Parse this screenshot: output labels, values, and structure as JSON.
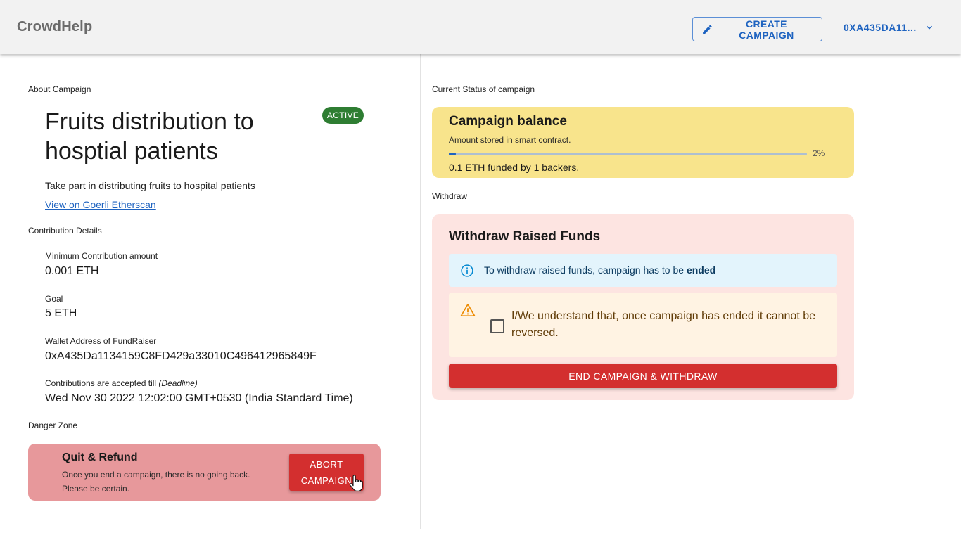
{
  "header": {
    "brand": "CrowdHelp",
    "create_campaign_label": "CREATE CAMPAIGN",
    "account_label": "0XA435DA11...",
    "create_icon": "pencil-icon",
    "account_icon": "chevron-down-icon"
  },
  "left": {
    "about_label": "About Campaign",
    "title": "Fruits distribution to hosptial patients",
    "status": "ACTIVE",
    "description": "Take part in distributing fruits to hospital patients",
    "etherscan_link": "View on Goerli Etherscan",
    "contribution_label": "Contribution Details",
    "min_contribution_label": "Minimum Contribution amount",
    "min_contribution_value": "0.001 ETH",
    "goal_label": "Goal",
    "goal_value": "5 ETH",
    "wallet_label": "Wallet Address of FundRaiser",
    "wallet_value": "0xA435Da1134159C8FD429a33010C496412965849F",
    "deadline_label": "Contributions are accepted till ",
    "deadline_hint": "(Deadline)",
    "deadline_value": "Wed Nov 30 2022 12:02:00 GMT+0530 (India Standard Time)",
    "danger_zone_label": "Danger Zone",
    "danger_title": "Quit & Refund",
    "danger_text": "Once you end a campaign, there is no going back. Please be certain.",
    "abort_label": "ABORT CAMPAIGN"
  },
  "right": {
    "status_label": "Current Status of campaign",
    "balance_title": "Campaign balance",
    "balance_sub": "Amount stored in smart contract.",
    "progress_percent": 2,
    "progress_text": "2%",
    "funded_text": "0.1 ETH funded by 1 backers.",
    "withdraw_label": "Withdraw",
    "withdraw_title": "Withdraw Raised Funds",
    "info_text": "To withdraw raised funds, campaign has to be ",
    "info_bold": "ended",
    "warning_text": "I/We understand that, once campaign has ended it cannot be reversed.",
    "end_button_label": "END CAMPAIGN & WITHDRAW"
  },
  "colors": {
    "accent": "#1e63c0",
    "active_chip": "#2e7d32",
    "danger": "#d32f2f",
    "balance_card": "#f8e48c",
    "withdraw_card": "#fde4e1",
    "danger_card": "#e7989b"
  }
}
